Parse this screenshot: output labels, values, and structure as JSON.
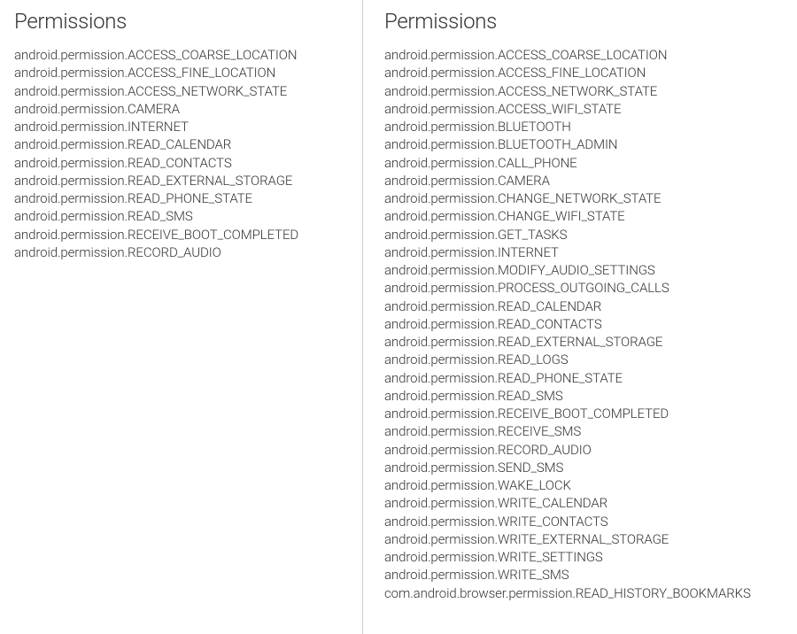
{
  "left": {
    "title": "Permissions",
    "items": [
      "android.permission.ACCESS_COARSE_LOCATION",
      "android.permission.ACCESS_FINE_LOCATION",
      "android.permission.ACCESS_NETWORK_STATE",
      "android.permission.CAMERA",
      "android.permission.INTERNET",
      "android.permission.READ_CALENDAR",
      "android.permission.READ_CONTACTS",
      "android.permission.READ_EXTERNAL_STORAGE",
      "android.permission.READ_PHONE_STATE",
      "android.permission.READ_SMS",
      "android.permission.RECEIVE_BOOT_COMPLETED",
      "android.permission.RECORD_AUDIO"
    ]
  },
  "right": {
    "title": "Permissions",
    "items": [
      "android.permission.ACCESS_COARSE_LOCATION",
      "android.permission.ACCESS_FINE_LOCATION",
      "android.permission.ACCESS_NETWORK_STATE",
      "android.permission.ACCESS_WIFI_STATE",
      "android.permission.BLUETOOTH",
      "android.permission.BLUETOOTH_ADMIN",
      "android.permission.CALL_PHONE",
      "android.permission.CAMERA",
      "android.permission.CHANGE_NETWORK_STATE",
      "android.permission.CHANGE_WIFI_STATE",
      "android.permission.GET_TASKS",
      "android.permission.INTERNET",
      "android.permission.MODIFY_AUDIO_SETTINGS",
      "android.permission.PROCESS_OUTGOING_CALLS",
      "android.permission.READ_CALENDAR",
      "android.permission.READ_CONTACTS",
      "android.permission.READ_EXTERNAL_STORAGE",
      "android.permission.READ_LOGS",
      "android.permission.READ_PHONE_STATE",
      "android.permission.READ_SMS",
      "android.permission.RECEIVE_BOOT_COMPLETED",
      "android.permission.RECEIVE_SMS",
      "android.permission.RECORD_AUDIO",
      "android.permission.SEND_SMS",
      "android.permission.WAKE_LOCK",
      "android.permission.WRITE_CALENDAR",
      "android.permission.WRITE_CONTACTS",
      "android.permission.WRITE_EXTERNAL_STORAGE",
      "android.permission.WRITE_SETTINGS",
      "android.permission.WRITE_SMS",
      "com.android.browser.permission.READ_HISTORY_BOOKMARKS"
    ]
  }
}
